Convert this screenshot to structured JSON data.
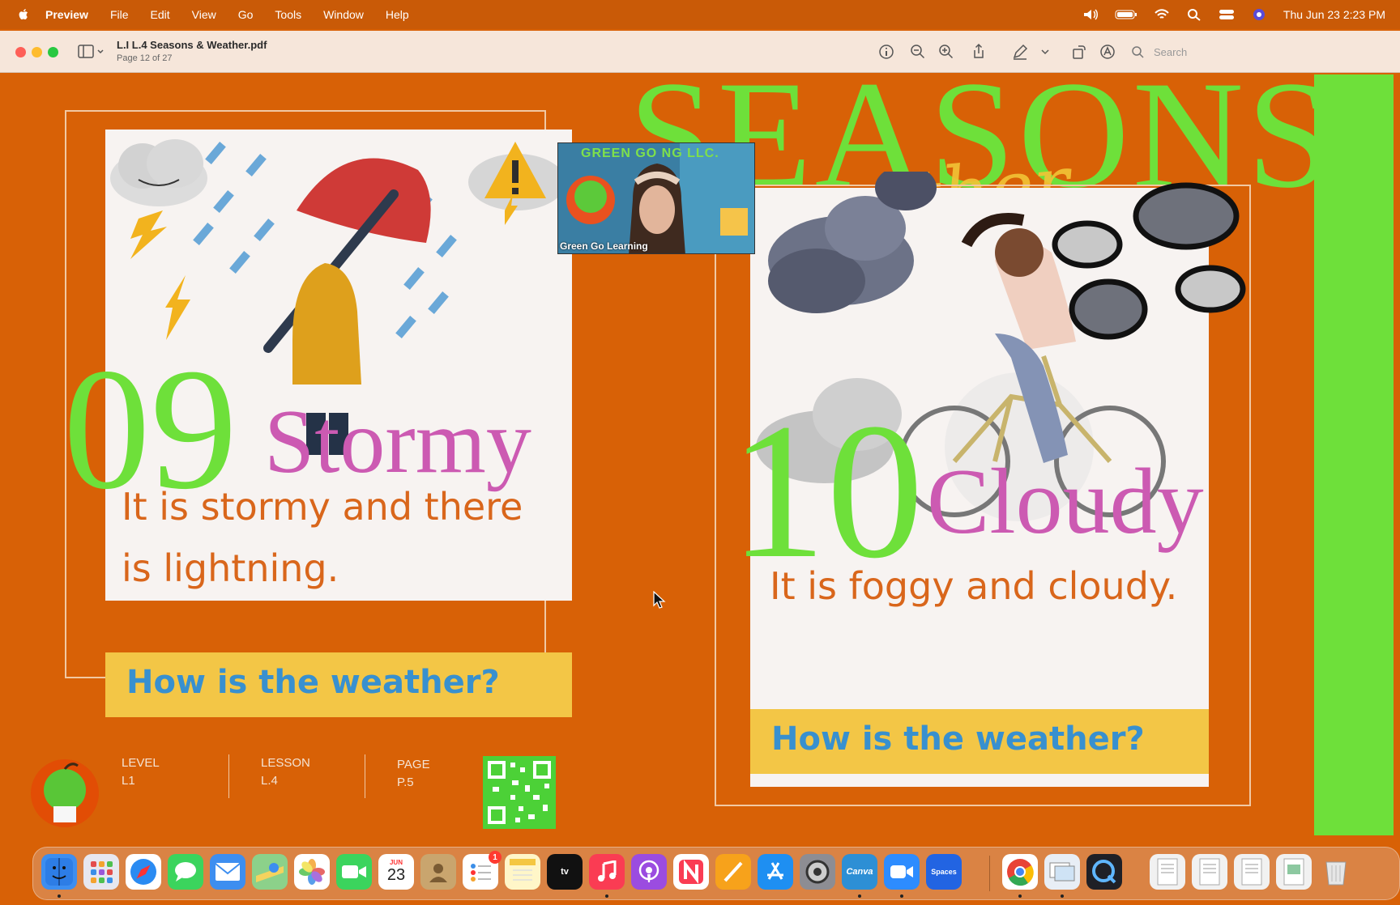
{
  "menubar": {
    "app_name": "Preview",
    "menus": [
      "File",
      "Edit",
      "View",
      "Go",
      "Tools",
      "Window",
      "Help"
    ],
    "clock": "Thu Jun 23  2:23 PM"
  },
  "window": {
    "title": "L.I L.4 Seasons &  Weather.pdf",
    "subtitle": "Page 12 of 27",
    "search_placeholder": "Search"
  },
  "slide": {
    "title": "SEASONS",
    "script_title": "weather",
    "card_left": {
      "number": "09",
      "word": "Stormy",
      "sentence_line1": "It is stormy and there",
      "sentence_line2": "is lightning.",
      "question": "How is the weather?"
    },
    "card_right": {
      "number": "10",
      "word": "Cloudy",
      "sentence": "It is foggy  and cloudy.",
      "question": "How is the weather?"
    },
    "footer": {
      "level_label": "LEVEL",
      "level_value": "L1",
      "lesson_label": "LESSON",
      "lesson_value": "L.4",
      "page_label": "PAGE",
      "page_value": "P.5"
    }
  },
  "video": {
    "banner": "GREEN GO    NG LLC.",
    "label": "Green Go Learning"
  },
  "dock": {
    "calendar_month": "JUN",
    "calendar_day": "23",
    "reminders_badge": "1",
    "appletv_label": "tv",
    "canva_label": "Canva",
    "spaces_label": "Spaces",
    "apps": [
      "Finder",
      "Launchpad",
      "Safari",
      "Messages",
      "Mail",
      "Maps",
      "Photos",
      "FaceTime",
      "Calendar",
      "Contacts",
      "Reminders",
      "Notes",
      "TV",
      "Music",
      "Podcasts",
      "News",
      "Pages",
      "App Store",
      "System Preferences",
      "Canva",
      "Zoom",
      "Spaces",
      "Chrome",
      "Preview",
      "QuickTime"
    ]
  },
  "colors": {
    "background": "#d86106",
    "accent_green": "#6ee03a",
    "word_pink": "#cc5ab2",
    "sentence_orange": "#d9661b",
    "question_blue": "#3890cf",
    "question_bar": "#f3c646"
  }
}
